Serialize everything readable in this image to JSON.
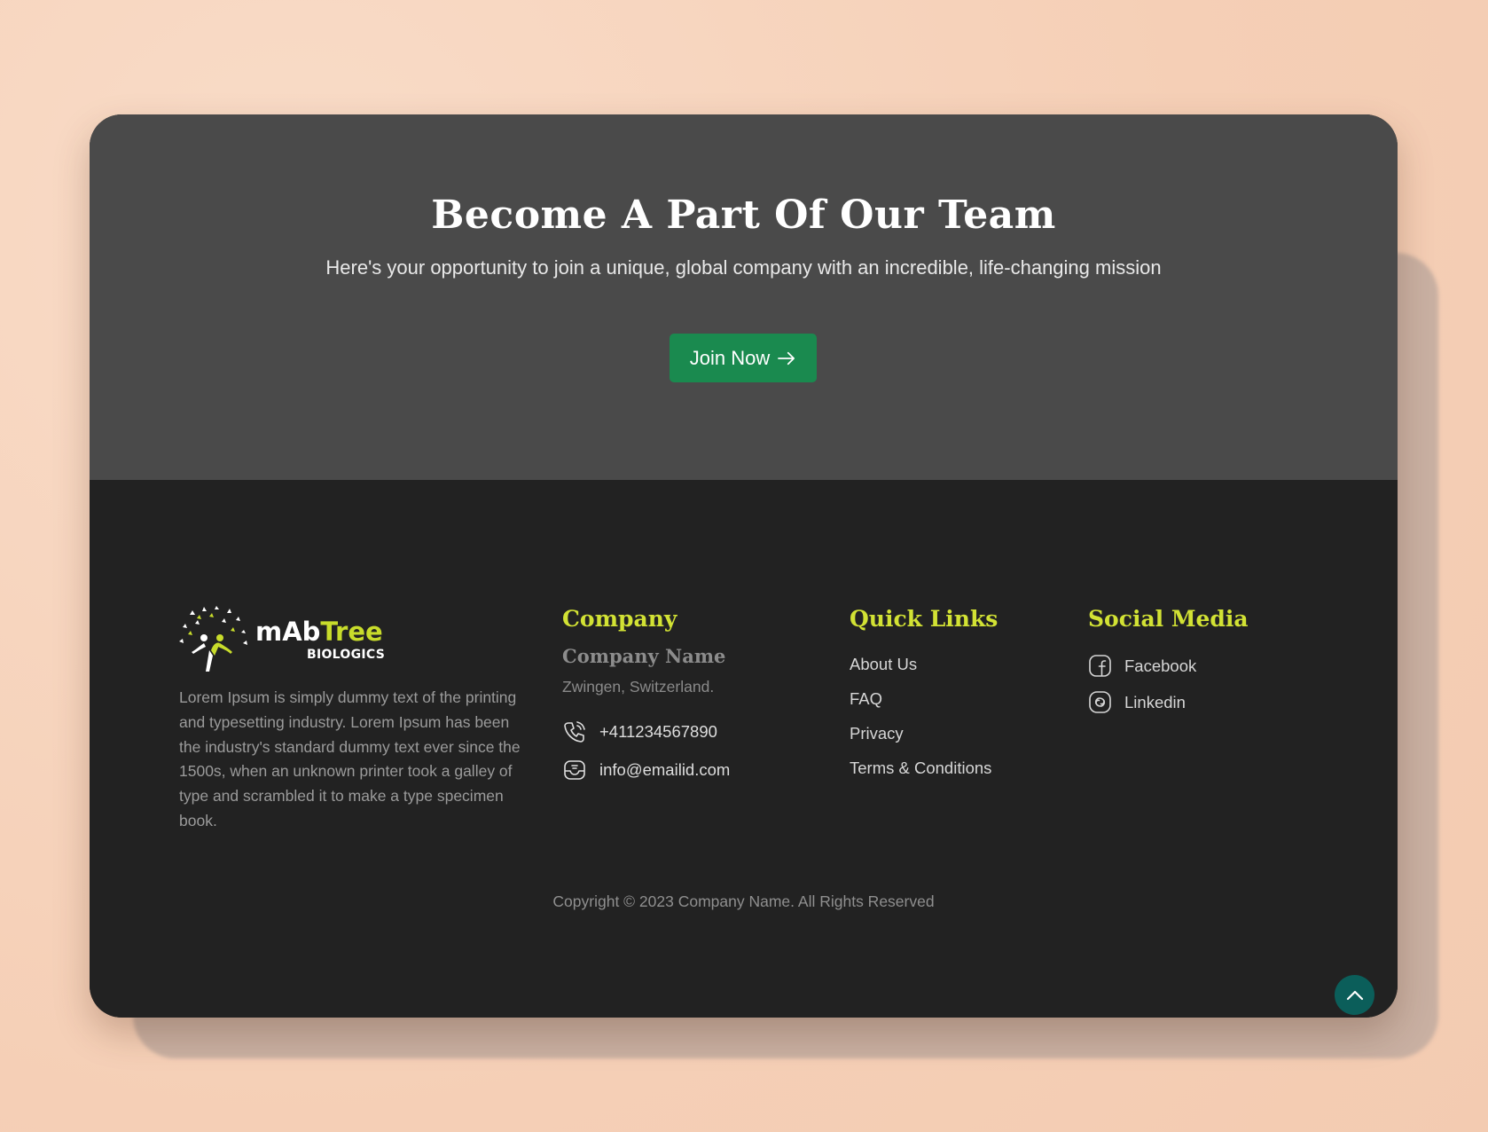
{
  "cta": {
    "title": "Become A Part Of Our Team",
    "subtitle": "Here's your opportunity to join a unique, global company with an incredible, life-changing mission",
    "button_label": "Join Now",
    "button_icon": "arrow-right-icon"
  },
  "brand": {
    "logo_icon": "tree-people-logo",
    "name_part1": "mAb",
    "name_part2": "Tree",
    "name_sub": "BIOLOGICS",
    "accent_color": "#c8dc2b"
  },
  "footer": {
    "about": "Lorem Ipsum is simply dummy text of the printing and typesetting industry. Lorem Ipsum has been the industry's standard dummy text ever since the 1500s, when an unknown printer took a galley of type and scrambled it to make a type specimen book.",
    "company": {
      "heading": "Company",
      "name": "Company Name",
      "location": "Zwingen, Switzerland.",
      "phone": "+411234567890",
      "phone_icon": "phone-icon",
      "email": "info@emailid.com",
      "email_icon": "email-icon"
    },
    "quick_links": {
      "heading": "Quick Links",
      "items": [
        "About Us",
        "FAQ",
        "Privacy",
        "Terms & Conditions"
      ]
    },
    "social": {
      "heading": "Social Media",
      "items": [
        {
          "label": "Facebook",
          "icon": "facebook-icon"
        },
        {
          "label": "Linkedin",
          "icon": "linkedin-icon"
        }
      ]
    },
    "copyright": "Copyright © 2023 Company Name. All Rights Reserved"
  },
  "scroll_top": {
    "icon": "chevron-up-icon",
    "color": "#0b5e5a"
  },
  "colors": {
    "background": "#f7d5bf",
    "cta_bg": "#4a4a4a",
    "footer_bg": "#222222",
    "button_green": "#1a8a4f",
    "heading_yellow": "#d2e234"
  }
}
